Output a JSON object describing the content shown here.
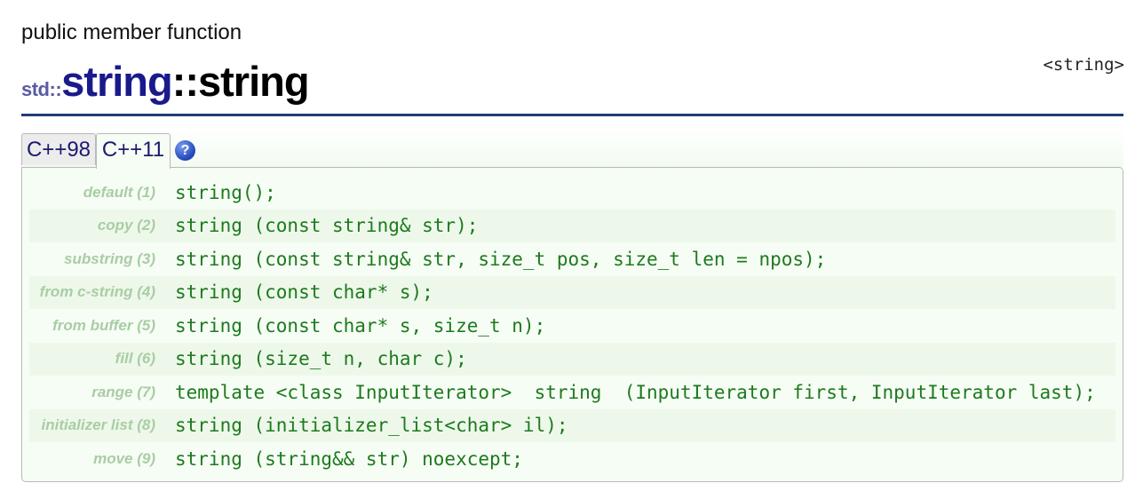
{
  "page": {
    "kind": "public member function",
    "header_file": "<string>",
    "title": {
      "namespace": "std::",
      "class_name": "string",
      "member": "::string"
    }
  },
  "tabs": [
    {
      "label": "C++98",
      "active": false
    },
    {
      "label": "C++11",
      "active": true
    }
  ],
  "help_icon": {
    "symbol": "?",
    "icon": "question-circle-icon",
    "color": "#2046b8"
  },
  "signatures": [
    {
      "label": "default (1)",
      "code": "string();"
    },
    {
      "label": "copy (2)",
      "code": "string (const string& str);"
    },
    {
      "label": "substring (3)",
      "code": "string (const string& str, size_t pos, size_t len = npos);"
    },
    {
      "label": "from c-string (4)",
      "code": "string (const char* s);"
    },
    {
      "label": "from buffer (5)",
      "code": "string (const char* s, size_t n);"
    },
    {
      "label": "fill (6)",
      "code": "string (size_t n, char c);"
    },
    {
      "label": "range (7)",
      "code": "template <class InputIterator>  string  (InputIterator first, InputIterator last);"
    },
    {
      "label": "initializer list (8)",
      "code": "string (initializer_list<char> il);"
    },
    {
      "label": "move (9)",
      "code": "string (string&& str) noexcept;"
    }
  ],
  "colors": {
    "title_class": "#1a1a8c",
    "rule": "#1f3c7a",
    "code": "#1d7a1d",
    "label": "#a9cda4",
    "box_bg": "#f6fdf5",
    "row_alt_bg": "#edf8ea"
  }
}
